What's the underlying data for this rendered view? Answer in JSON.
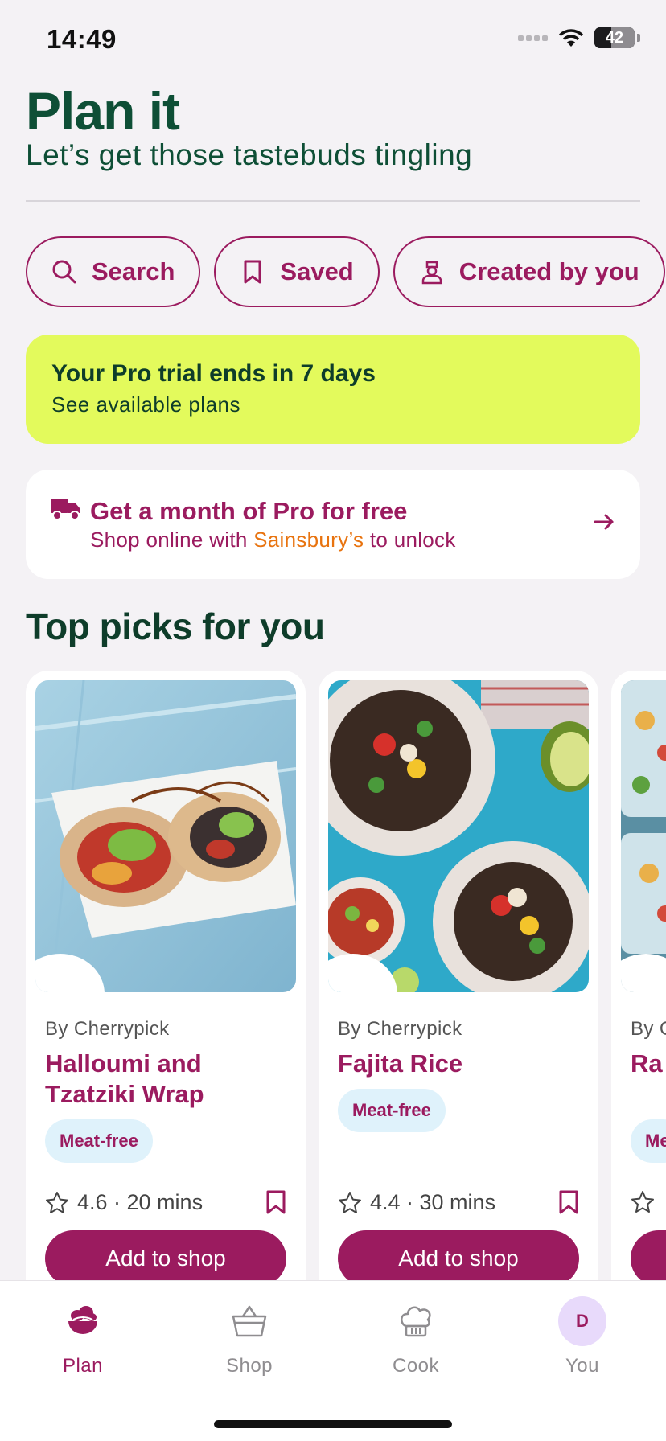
{
  "status_bar": {
    "time": "14:49",
    "battery": "42"
  },
  "header": {
    "title": "Plan it",
    "subtitle": "Let’s get those tastebuds tingling"
  },
  "chips": {
    "search": "Search",
    "saved": "Saved",
    "created": "Created by you"
  },
  "trial_banner": {
    "title": "Your Pro trial ends in 7 days",
    "subtitle": "See available plans"
  },
  "promo": {
    "title": "Get a month of Pro for free",
    "sub_before": "Shop online with ",
    "brand": "Sainsbury’s",
    "sub_after": " to unlock"
  },
  "section": {
    "title": "Top picks for you"
  },
  "recipes": [
    {
      "byline": "By Cherrypick",
      "name": "Halloumi and Tzatziki Wrap",
      "tag": "Meat-free",
      "meta": "4.6 · 20 mins",
      "button": "Add to shop"
    },
    {
      "byline": "By Cherrypick",
      "name": "Fajita Rice",
      "tag": "Meat-free",
      "meta": "4.4 · 30 mins",
      "button": "Add to shop"
    },
    {
      "byline": "By C",
      "name": "Ra Sal",
      "tag": "Me",
      "meta": ""
    }
  ],
  "tabbar": {
    "plan": "Plan",
    "shop": "Shop",
    "cook": "Cook",
    "you": "You",
    "avatar_initial": "D"
  },
  "colors": {
    "brand": "#9b1b5f",
    "heading_green": "#0e4f36",
    "trial_bg": "#e3fa5c",
    "tag_bg": "#dff2fb",
    "background": "#f4f2f5"
  }
}
